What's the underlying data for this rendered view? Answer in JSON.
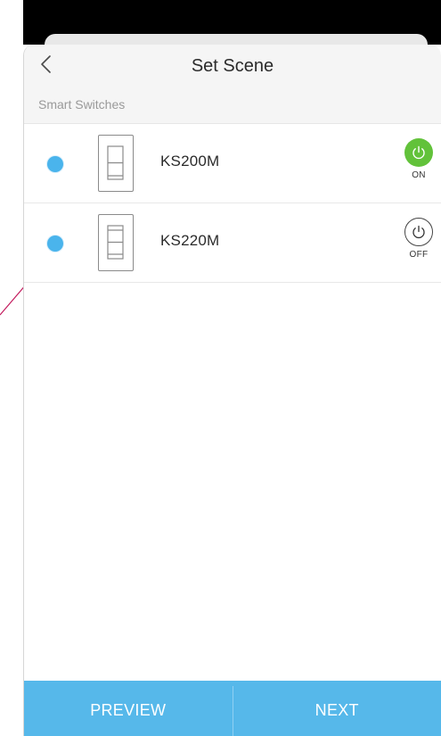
{
  "header": {
    "title": "Set Scene",
    "back_icon": "chevron-left-icon"
  },
  "section": {
    "label": "Smart Switches"
  },
  "devices": [
    {
      "name": "KS200M",
      "selected": true,
      "state": "ON",
      "state_color": "#62c23a",
      "icon": "single-switch-icon"
    },
    {
      "name": "KS220M",
      "selected": true,
      "state": "OFF",
      "state_color": "#ffffff",
      "icon": "dimmer-switch-icon"
    }
  ],
  "footer": {
    "preview_label": "PREVIEW",
    "next_label": "NEXT"
  },
  "colors": {
    "accent": "#56b8ea",
    "radio": "#4ab4ec",
    "on": "#62c23a",
    "header_bg": "#f5f5f5"
  }
}
